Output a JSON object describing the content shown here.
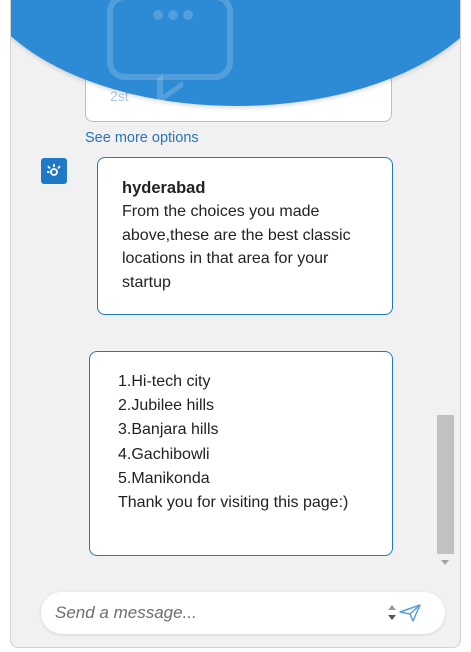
{
  "previous_card": {
    "text": "2st"
  },
  "see_more_label": "See more options",
  "messages": [
    {
      "sender": "bot",
      "title": "hyderabad",
      "body": "From the choices you made above,these are the best classic locations in that area for your startup"
    },
    {
      "sender": "bot",
      "lines": [
        "1.Hi-tech city",
        "2.Jubilee hills",
        "3.Banjara hills",
        "4.Gachibowli",
        "5.Manikonda",
        "Thank you for visiting this page:)"
      ]
    }
  ],
  "composer": {
    "placeholder": "Send a message..."
  },
  "scrollbar": {
    "thumb_position_fraction": 0.72
  },
  "colors": {
    "accent": "#1f78c8",
    "header": "#2d8ad4",
    "link": "#2a73b8"
  },
  "icons": {
    "header": "chat-bubble-icon",
    "avatar": "bot-logo-icon",
    "send": "send-plane-icon"
  }
}
